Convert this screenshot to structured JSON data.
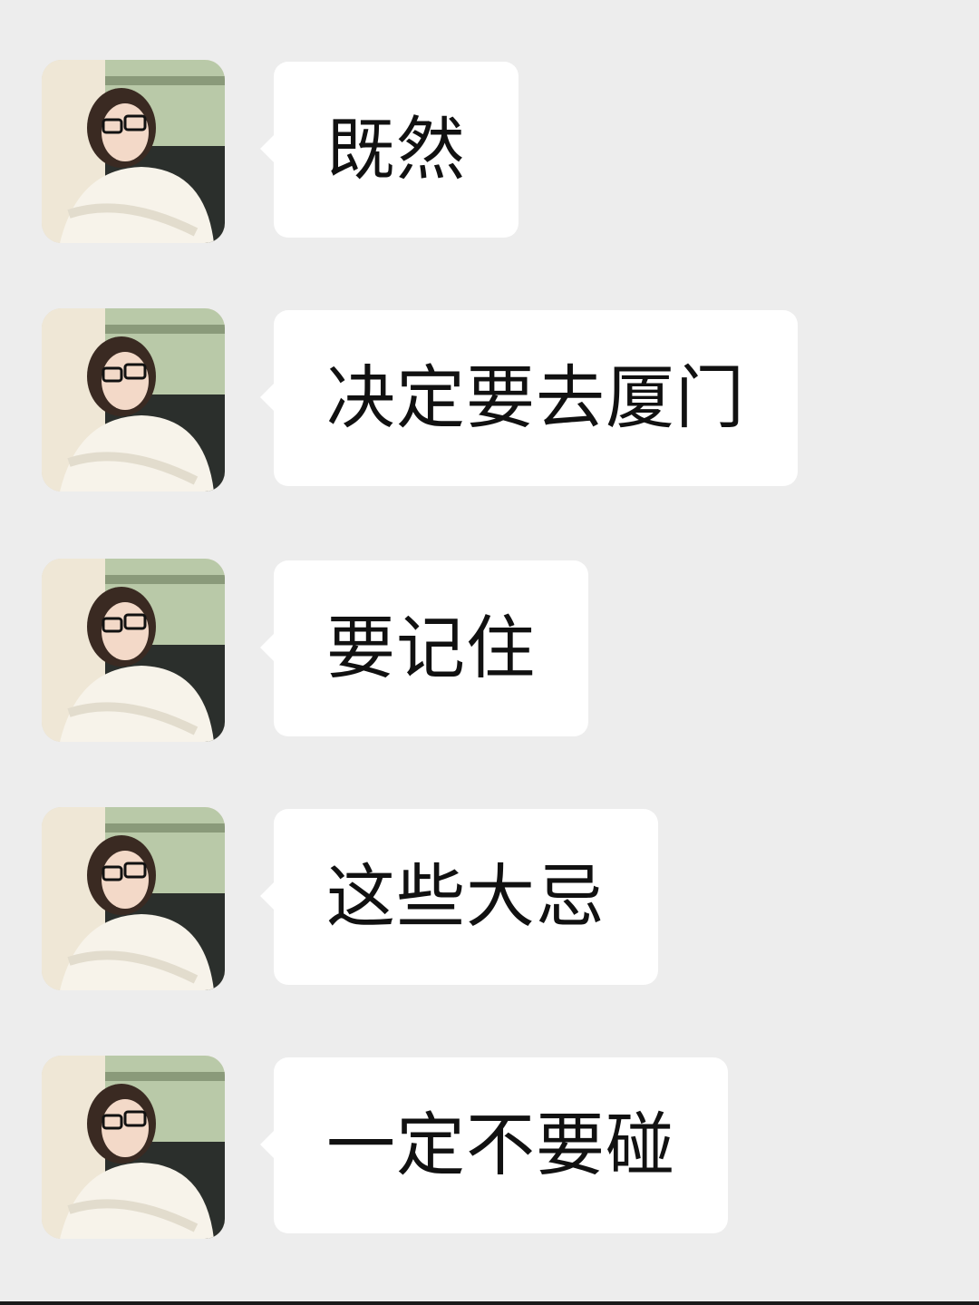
{
  "chat": {
    "messages": [
      {
        "text": "既然",
        "sender_avatar": "avatar-photo"
      },
      {
        "text": "决定要去厦门",
        "sender_avatar": "avatar-photo"
      },
      {
        "text": "要记住",
        "sender_avatar": "avatar-photo"
      },
      {
        "text": "这些大忌",
        "sender_avatar": "avatar-photo"
      },
      {
        "text": "一定不要碰",
        "sender_avatar": "avatar-photo"
      }
    ]
  },
  "colors": {
    "background": "#ededed",
    "bubble": "#ffffff",
    "text": "#111111"
  }
}
